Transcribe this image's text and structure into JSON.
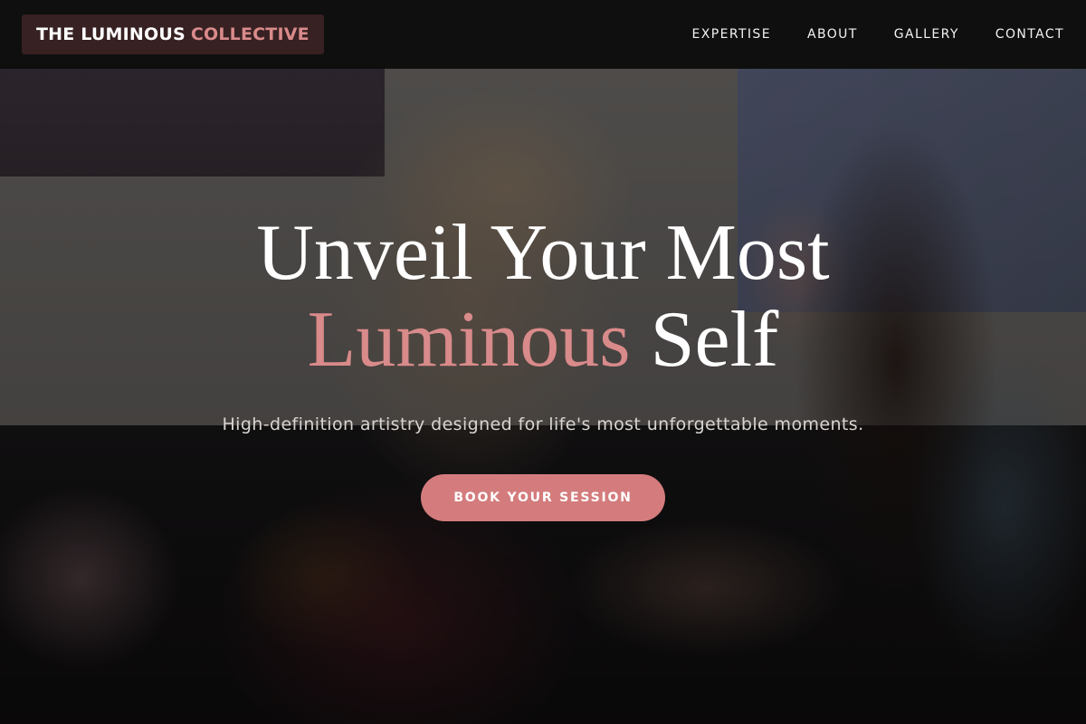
{
  "nav": {
    "logo_main": "THE LUMINOUS",
    "logo_accent": "COLLECTIVE",
    "links": [
      {
        "label": "EXPERTISE"
      },
      {
        "label": "ABOUT"
      },
      {
        "label": "GALLERY"
      },
      {
        "label": "CONTACT"
      }
    ]
  },
  "hero": {
    "headline_line1": "Unveil Your Most",
    "headline_accent": "Luminous",
    "headline_end": "Self",
    "subtitle": "High-definition artistry designed for life's most unforgettable moments.",
    "cta_label": "BOOK YOUR SESSION"
  },
  "colors": {
    "accent": "#d98a8a",
    "button": "#d47c7d",
    "nav_bg": "#0a0a0a",
    "text": "#ffffff"
  }
}
